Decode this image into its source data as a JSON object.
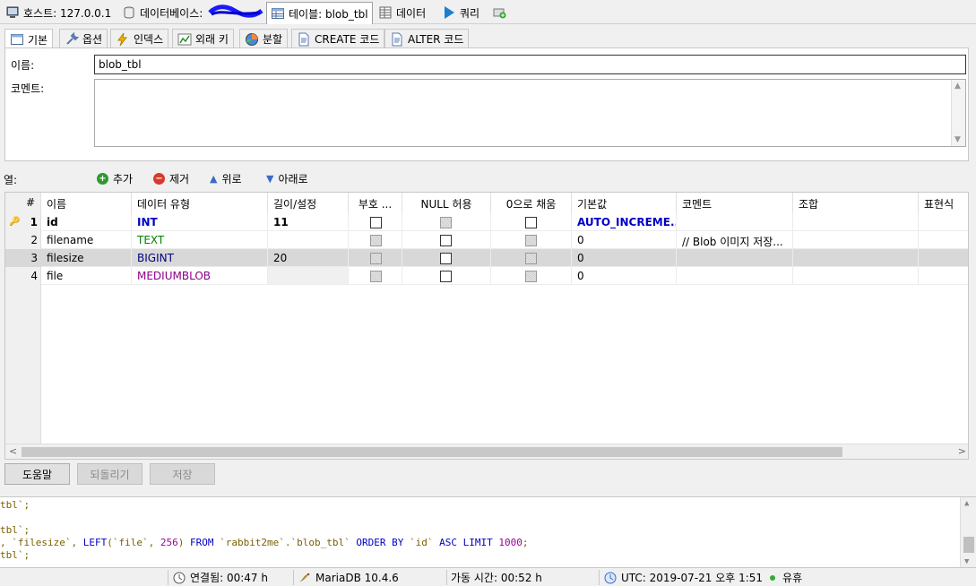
{
  "topbar": {
    "host_label": "호스트: 127.0.0.1",
    "db_label": "데이터베이스:",
    "table_label": "테이블: blob_tbl",
    "data_label": "데이터",
    "query_label": "쿼리"
  },
  "inner_tabs": [
    "기본",
    "옵션",
    "인덱스",
    "외래 키",
    "분할",
    "CREATE 코드",
    "ALTER 코드"
  ],
  "basic": {
    "name_label": "이름:",
    "name_value": "blob_tbl",
    "comment_label": "코멘트:",
    "comment_value": ""
  },
  "columns_toolbar": {
    "label": "열:",
    "add": "추가",
    "remove": "제거",
    "up": "위로",
    "down": "아래로"
  },
  "grid": {
    "headers": [
      "#",
      "이름",
      "데이터 유형",
      "길이/설정",
      "부호 ...",
      "NULL 허용",
      "0으로 채움",
      "기본값",
      "코멘트",
      "조합",
      "표현식"
    ],
    "rows": [
      {
        "num": "1",
        "name": "id",
        "type": "INT",
        "length": "11",
        "unsigned": false,
        "allow_null": false,
        "zerofill": false,
        "default": "AUTO_INCREME...",
        "comment": "",
        "type_color": "#0000c8",
        "primary_key": true
      },
      {
        "num": "2",
        "name": "filename",
        "type": "TEXT",
        "length": "",
        "unsigned": false,
        "allow_null": false,
        "zerofill": false,
        "default": "0",
        "comment": "// Blob 이미지 저장...",
        "type_color": "#008000",
        "primary_key": false
      },
      {
        "num": "3",
        "name": "filesize",
        "type": "BIGINT",
        "length": "20",
        "unsigned": false,
        "allow_null": false,
        "zerofill": false,
        "default": "0",
        "comment": "",
        "type_color": "#000080",
        "primary_key": false
      },
      {
        "num": "4",
        "name": "file",
        "type": "MEDIUMBLOB",
        "length": "",
        "unsigned": false,
        "allow_null": false,
        "zerofill": false,
        "default": "0",
        "comment": "",
        "type_color": "#8b008b",
        "primary_key": false
      }
    ]
  },
  "buttons": {
    "help": "도움말",
    "revert": "되돌리기",
    "save": "저장"
  },
  "sql_log": {
    "line1": "tbl`;",
    "line2": "tbl`;",
    "line3_a": ", `filesize`, ",
    "line3_kw1": "LEFT",
    "line3_b": "(`file`, ",
    "line3_num1": "256",
    "line3_c": ") ",
    "line3_kw2": "FROM",
    "line3_d": " `rabbit2me`.`blob_tbl` ",
    "line3_kw3": "ORDER BY",
    "line3_e": " `id` ",
    "line3_kw4": "ASC LIMIT",
    "line3_num2": "1000",
    "line3_f": ";",
    "line4": "tbl`;"
  },
  "status": {
    "connected": "연결됨: 00:47 h",
    "server": "MariaDB 10.4.6",
    "uptime": "가동 시간: 00:52 h",
    "utc": "UTC: 2019-07-21 오후 1:51",
    "state": "유휴"
  }
}
